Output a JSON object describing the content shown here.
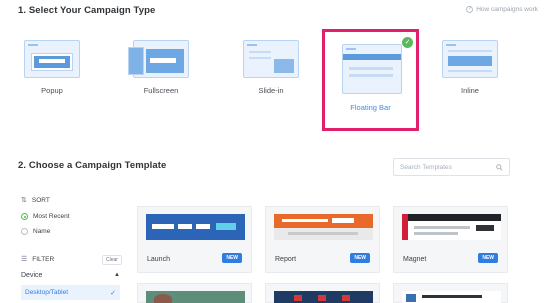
{
  "step1": {
    "title": "1. Select Your Campaign Type",
    "help": "How campaigns work"
  },
  "types": [
    {
      "label": "Popup"
    },
    {
      "label": "Fullscreen"
    },
    {
      "label": "Slide-in"
    },
    {
      "label": "Floating Bar",
      "selected": true
    },
    {
      "label": "Inline"
    }
  ],
  "step2": {
    "title": "2. Choose a Campaign Template",
    "search_placeholder": "Search Templates"
  },
  "sidebar": {
    "sort_title": "SORT",
    "sort_options": [
      "Most Recent",
      "Name"
    ],
    "filter_title": "FILTER",
    "clear": "Clear",
    "device_title": "Device",
    "device_selected": "Desktop/Tablet"
  },
  "templates": [
    {
      "name": "Launch",
      "badge": "NEW"
    },
    {
      "name": "Report",
      "badge": "NEW"
    },
    {
      "name": "Magnet",
      "badge": "NEW"
    }
  ],
  "colors": {
    "accent": "#2f7de1",
    "highlight": "#e0206a",
    "selected_label": "#3d8fe0"
  }
}
